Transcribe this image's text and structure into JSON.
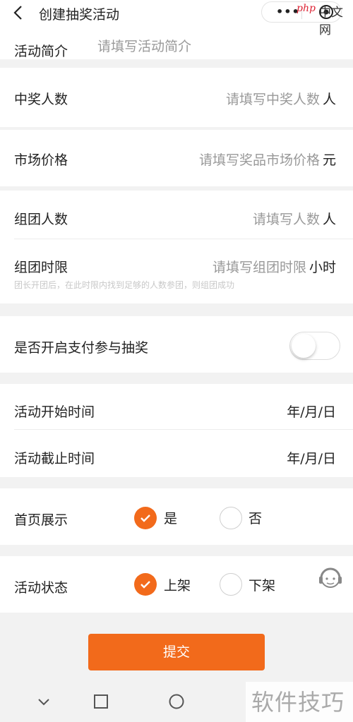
{
  "header": {
    "title": "创建抽奖活动",
    "capsule_more": "•••"
  },
  "watermark": {
    "php": "php",
    "cn": "中文网",
    "bottom": "软件技巧"
  },
  "fields": {
    "intro": {
      "label": "活动简介",
      "placeholder": "请填写活动简介"
    },
    "winners": {
      "label": "中奖人数",
      "placeholder": "请填写中奖人数",
      "unit": "人"
    },
    "price": {
      "label": "市场价格",
      "placeholder": "请填写奖品市场价格",
      "unit": "元"
    },
    "group_size": {
      "label": "组团人数",
      "placeholder": "请填写人数",
      "unit": "人"
    },
    "group_time": {
      "label": "组团时限",
      "placeholder": "请填写组团时限",
      "unit": "小时",
      "hint": "团长开团后，在此时限内找到足够的人数参团，则组团成功"
    },
    "pay_toggle": {
      "label": "是否开启支付参与抽奖",
      "on": false
    },
    "start_time": {
      "label": "活动开始时间",
      "value": "年/月/日"
    },
    "end_time": {
      "label": "活动截止时间",
      "value": "年/月/日"
    },
    "homepage": {
      "label": "首页展示",
      "options": [
        "是",
        "否"
      ],
      "selected": "是"
    },
    "status": {
      "label": "活动状态",
      "options": [
        "上架",
        "下架"
      ],
      "selected": "上架"
    }
  },
  "submit_label": "提交",
  "colors": {
    "accent": "#f26a1b",
    "placeholder": "#999999",
    "background": "#f2f2f2"
  }
}
